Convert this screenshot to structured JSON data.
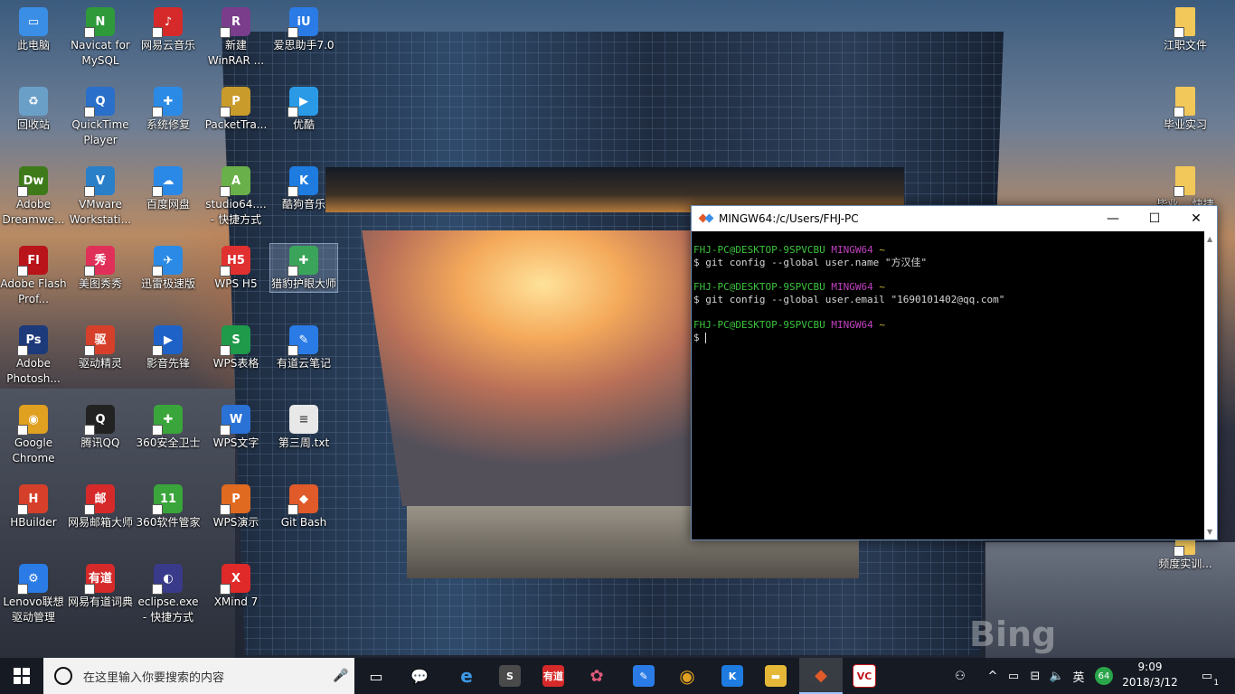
{
  "desktop": {
    "icons": [
      {
        "label": "此电脑",
        "color": "#3a8ee6",
        "glyph": "▭"
      },
      {
        "label": "Navicat for MySQL",
        "color": "#2e9a3a",
        "glyph": "N"
      },
      {
        "label": "网易云音乐",
        "color": "#d62a2a",
        "glyph": "♪"
      },
      {
        "label": "新建 WinRAR ...",
        "color": "#7a3d8c",
        "glyph": "R"
      },
      {
        "label": "爱思助手7.0",
        "color": "#2a7be6",
        "glyph": "iU"
      },
      {
        "label": "回收站",
        "color": "#6aa0c8",
        "glyph": "♻"
      },
      {
        "label": "QuickTime Player",
        "color": "#2a6fc9",
        "glyph": "Q"
      },
      {
        "label": "系统修复",
        "color": "#2a8ae6",
        "glyph": "✚"
      },
      {
        "label": "PacketTra...",
        "color": "#c99b2a",
        "glyph": "P"
      },
      {
        "label": "优酷",
        "color": "#2a9ae6",
        "glyph": "▶"
      },
      {
        "label": "Adobe Dreamwe...",
        "color": "#3e7a1a",
        "glyph": "Dw"
      },
      {
        "label": "VMware Workstati...",
        "color": "#2a7fc9",
        "glyph": "V"
      },
      {
        "label": "百度网盘",
        "color": "#2a88e6",
        "glyph": "☁"
      },
      {
        "label": "studio64.... - 快捷方式",
        "color": "#6ab04a",
        "glyph": "A"
      },
      {
        "label": "酷狗音乐",
        "color": "#1e7be0",
        "glyph": "K"
      },
      {
        "label": "Adobe Flash Prof...",
        "color": "#b8141a",
        "glyph": "Fl"
      },
      {
        "label": "美图秀秀",
        "color": "#e0305a",
        "glyph": "秀"
      },
      {
        "label": "迅雷极速版",
        "color": "#2a8ae6",
        "glyph": "✈"
      },
      {
        "label": "WPS H5",
        "color": "#e03030",
        "glyph": "H5"
      },
      {
        "label": "猎豹护眼大师",
        "color": "#3aa55a",
        "glyph": "✚"
      },
      {
        "label": "Adobe Photosh...",
        "color": "#1d3a7a",
        "glyph": "Ps"
      },
      {
        "label": "驱动精灵",
        "color": "#d6402a",
        "glyph": "驱"
      },
      {
        "label": "影音先锋",
        "color": "#1e62c8",
        "glyph": "▶"
      },
      {
        "label": "WPS表格",
        "color": "#1f9a4a",
        "glyph": "S"
      },
      {
        "label": "有道云笔记",
        "color": "#2a7be6",
        "glyph": "✎"
      },
      {
        "label": "Google Chrome",
        "color": "#e0a020",
        "glyph": "◉"
      },
      {
        "label": "腾讯QQ",
        "color": "#222222",
        "glyph": "Q"
      },
      {
        "label": "360安全卫士",
        "color": "#3aa53a",
        "glyph": "✚"
      },
      {
        "label": "WPS文字",
        "color": "#2a72d6",
        "glyph": "W"
      },
      {
        "label": "第三周.txt",
        "color": "#e8e8e8",
        "glyph": "≡"
      },
      {
        "label": "HBuilder",
        "color": "#d6402a",
        "glyph": "H"
      },
      {
        "label": "网易邮箱大师",
        "color": "#d62a2a",
        "glyph": "邮"
      },
      {
        "label": "360软件管家",
        "color": "#3aa53a",
        "glyph": "11"
      },
      {
        "label": "WPS演示",
        "color": "#e06a20",
        "glyph": "P"
      },
      {
        "label": "Git Bash",
        "color": "#e05a2a",
        "glyph": "◆"
      },
      {
        "label": "Lenovo联想驱动管理",
        "color": "#2a7be6",
        "glyph": "⚙"
      },
      {
        "label": "网易有道词典",
        "color": "#d62a2a",
        "glyph": "有道"
      },
      {
        "label": "eclipse.exe - 快捷方式",
        "color": "#3a3a8a",
        "glyph": "◐"
      },
      {
        "label": "XMind 7",
        "color": "#e02a2a",
        "glyph": "X"
      }
    ],
    "right_icons": [
      {
        "label": "江职文件"
      },
      {
        "label": "毕业实习"
      },
      {
        "label": "毕业... 快捷"
      },
      {
        "label": "频度实训..."
      }
    ],
    "watermark": "Bing"
  },
  "terminal": {
    "title": "MINGW64:/c/Users/FHJ-PC",
    "user_host": "FHJ-PC@DESKTOP-9SPVCBU",
    "env": "MINGW64",
    "path": "~",
    "commands": [
      "$ git config --global user.name \"方汉佳\"",
      "$ git config --global user.email \"1690101402@qq.com\""
    ],
    "prompt_symbol": "$ "
  },
  "taskbar": {
    "search_placeholder": "在这里输入你要搜索的内容",
    "apps": [
      {
        "name": "task-view",
        "color": "transparent",
        "glyph": "▭"
      },
      {
        "name": "wechat",
        "color": "transparent",
        "glyph": "💬"
      },
      {
        "name": "edge",
        "color": "transparent",
        "glyph": "e"
      },
      {
        "name": "sublime",
        "color": "#4a4a4a",
        "glyph": "S"
      },
      {
        "name": "youdao",
        "color": "#d62a2a",
        "glyph": "有道"
      },
      {
        "name": "meitu",
        "color": "transparent",
        "glyph": "✿"
      },
      {
        "name": "youdao-note",
        "color": "#2a7be6",
        "glyph": "✎"
      },
      {
        "name": "chrome",
        "color": "transparent",
        "glyph": "◉"
      },
      {
        "name": "kugou",
        "color": "#1e7be0",
        "glyph": "K"
      },
      {
        "name": "file-explorer",
        "color": "#e6b838",
        "glyph": "▬"
      },
      {
        "name": "git-bash",
        "color": "transparent",
        "glyph": "◆"
      },
      {
        "name": "vc",
        "color": "#fff",
        "glyph": "VC"
      }
    ],
    "tray": {
      "ime": "英",
      "badge": "64",
      "time": "9:09",
      "date": "2018/3/12",
      "notifications": "1"
    }
  }
}
